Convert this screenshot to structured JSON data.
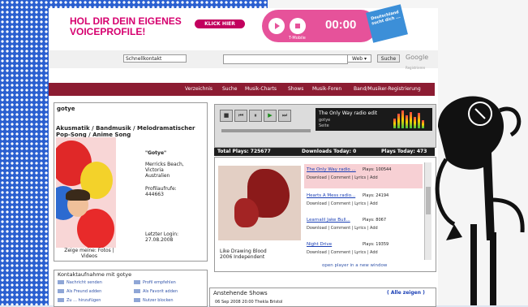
{
  "banner": {
    "line1": "HOL DIR DEIN EIGENES",
    "line2": "VOICEPROFILE!",
    "cta": "KLICK HIER",
    "player_time": "00:00",
    "brand": "T-Mobile",
    "sticker": "Deutschland sucht dich ..."
  },
  "search": {
    "select_value": "Schnellkontakt",
    "scope": "Web ▾",
    "button": "Suche",
    "google": "Google",
    "register": "Registrieren"
  },
  "nav": [
    "Verzeichnis",
    "Suche",
    "Musik-Charts",
    "Shows",
    "Musik-Foren",
    "Band/Musiker-Registrierung"
  ],
  "profile": {
    "name": "gotye",
    "genre": "Akusmatik / Bandmusik / Melodramatischer Pop-Song / Anime Song",
    "quote": "\"Gotye\"",
    "location_1": "Merricks Beach,",
    "location_2": "Victoria",
    "location_3": "Australien",
    "views_label": "Profilaufrufe:",
    "views": "444663",
    "last_login_label": "Letzter Login:",
    "last_login": "27.08.2008",
    "caption_1": "Zeige meine: Fotos |",
    "caption_2": "Videos"
  },
  "contact": {
    "title": "Kontaktaufnahme mit gotye",
    "items": [
      "Nachricht senden",
      "Profil empfehlen",
      "Als Freund adden",
      "Als Favorit adden",
      "Zu ... hinzufügen",
      "Nutzer blocken"
    ]
  },
  "player": {
    "song": "The Only Way radio edit",
    "artist": "gotye",
    "sub": "Seite"
  },
  "stats": {
    "total": "Total Plays: 725677",
    "downloads": "Downloads Today: 0",
    "plays_today": "Plays Today: 473"
  },
  "songs": [
    {
      "title": "The Only Way radio ...",
      "plays": "Plays: 100544",
      "actions": "Download  |  Comment  |  Lyrics  |  Add"
    },
    {
      "title": "Hearts A Mess radio...",
      "plays": "Plays: 24194",
      "actions": "Download  |  Comment  |  Lyrics  |  Add"
    },
    {
      "title": "Learnalil Jake Bull...",
      "plays": "Plays: 8067",
      "actions": "Download  |  Comment  |  Lyrics  |  Add"
    },
    {
      "title": "Night Drive",
      "plays": "Plays: 19359",
      "actions": "Download  |  Comment  |  Lyrics  |  Add"
    }
  ],
  "album": {
    "name": "Like Drawing Blood",
    "year": "2006 Independent"
  },
  "open_window": "open player in a new window",
  "shows": {
    "title": "Anstehende Shows",
    "all": "( Alle zeigen )",
    "row": "06 Sep 2008    20:00  Thekla                                         Bristol"
  }
}
